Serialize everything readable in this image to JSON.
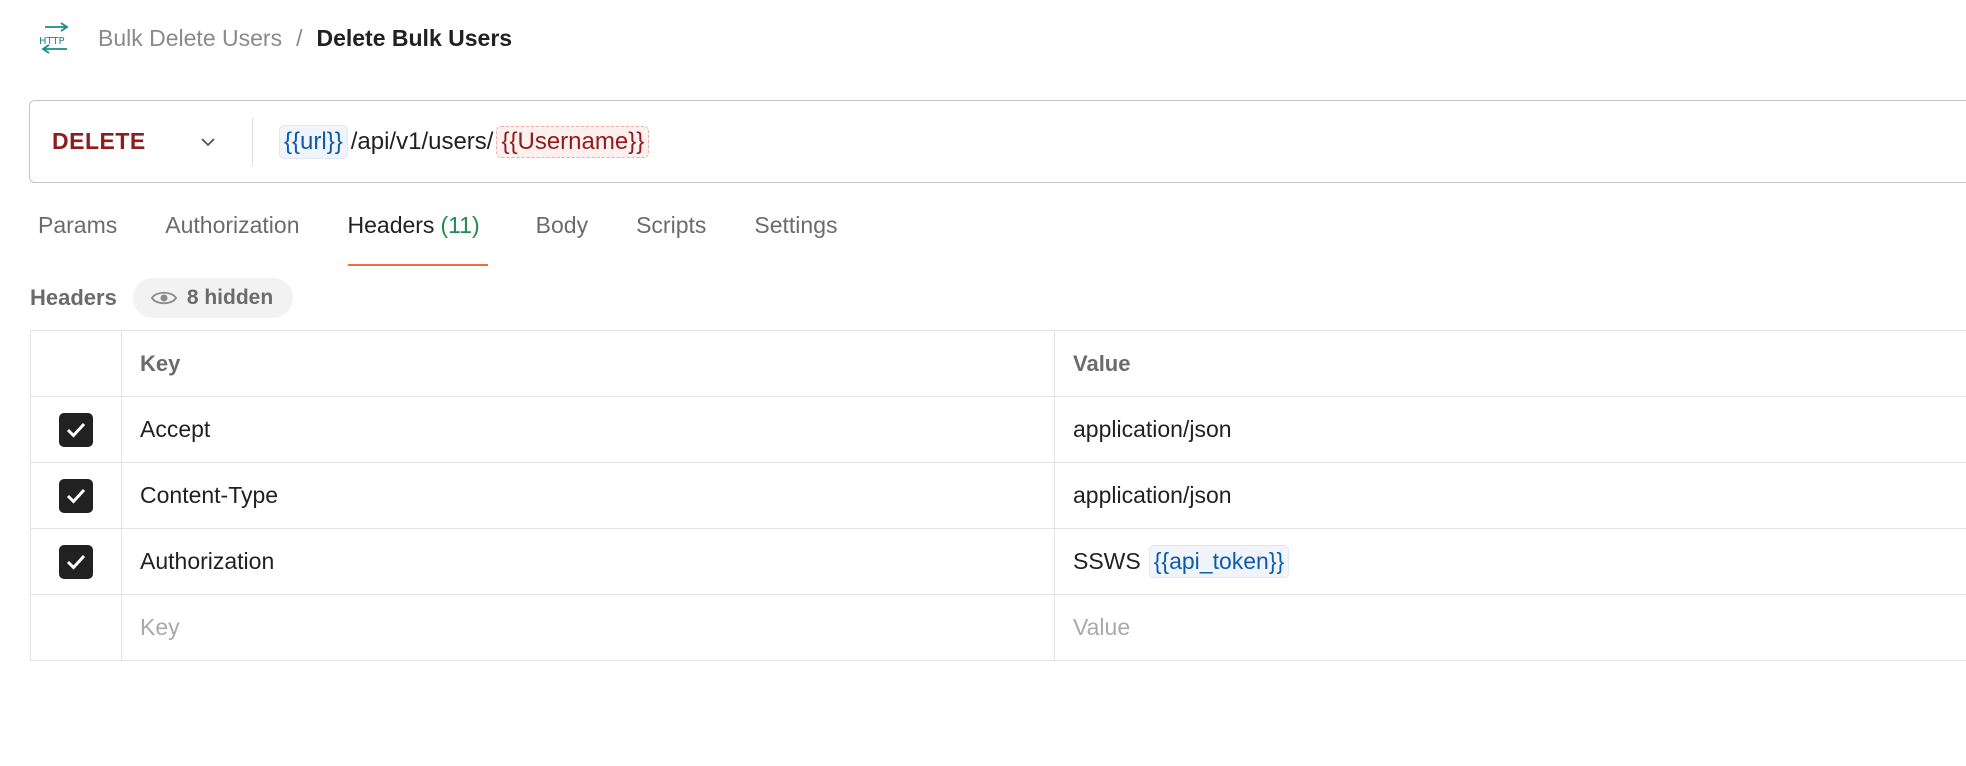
{
  "breadcrumb": {
    "icon": "http-icon",
    "parent": "Bulk Delete Users",
    "separator": "/",
    "current": "Delete Bulk Users"
  },
  "request": {
    "method": "DELETE",
    "method_color": "#8f1d1d",
    "url_var_1": "{{url}}",
    "url_path": "/api/v1/users/",
    "url_var_2": "{{Username}}"
  },
  "tabs": [
    {
      "label": "Params"
    },
    {
      "label": "Authorization"
    },
    {
      "label": "Headers",
      "count": "(11)",
      "active": true
    },
    {
      "label": "Body"
    },
    {
      "label": "Scripts"
    },
    {
      "label": "Settings"
    }
  ],
  "headers_section": {
    "title": "Headers",
    "hidden_label": "8 hidden"
  },
  "table": {
    "columns": {
      "key": "Key",
      "value": "Value"
    },
    "rows": [
      {
        "checked": true,
        "key": "Accept",
        "value": "application/json"
      },
      {
        "checked": true,
        "key": "Content-Type",
        "value": "application/json"
      },
      {
        "checked": true,
        "key": "Authorization",
        "value_prefix": "SSWS",
        "value_var": "{{api_token}}"
      }
    ],
    "new_row": {
      "key_placeholder": "Key",
      "value_placeholder": "Value"
    }
  },
  "colors": {
    "accent_tab": "#f26b3a",
    "count_green": "#1f8b4c",
    "var_blue": "#0b5cad"
  }
}
